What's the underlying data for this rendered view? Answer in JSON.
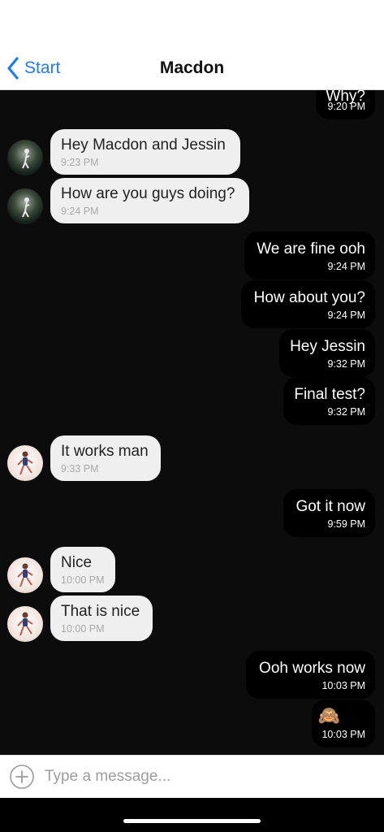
{
  "header": {
    "back_label": "Start",
    "title": "Macdon"
  },
  "messages": [
    {
      "side": "out",
      "text": "Why?",
      "time": "9:20 PM"
    },
    {
      "side": "in",
      "avatar": "dark-portrait",
      "text": "Hey Macdon and Jessin",
      "time": "9:23 PM"
    },
    {
      "side": "in",
      "avatar": "dark-portrait",
      "text": "How are you guys doing?",
      "time": "9:24 PM"
    },
    {
      "side": "out",
      "text": "We are fine ooh",
      "time": "9:24 PM"
    },
    {
      "side": "out",
      "text": "How about you?",
      "time": "9:24 PM"
    },
    {
      "side": "out",
      "text": "Hey Jessin",
      "time": "9:32 PM"
    },
    {
      "side": "out",
      "text": "Final test?",
      "time": "9:32 PM"
    },
    {
      "side": "in",
      "avatar": "light-portrait",
      "text": "It works man",
      "time": "9:33 PM"
    },
    {
      "side": "out",
      "text": "Got it now",
      "time": "9:59 PM"
    },
    {
      "side": "in",
      "avatar": "light-portrait",
      "text": "Nice",
      "time": "10:00 PM"
    },
    {
      "side": "in",
      "avatar": "light-portrait",
      "text": "That is nice",
      "time": "10:00 PM"
    },
    {
      "side": "out",
      "text": "Ooh works now",
      "time": "10:03 PM"
    },
    {
      "side": "out",
      "text": "🙈",
      "time": "10:03 PM"
    }
  ],
  "composer": {
    "placeholder": "Type a message...",
    "add_icon": "plus-circle-icon"
  },
  "colors": {
    "accent": "#1e7bf6",
    "chat_background": "#0b0c0b",
    "outgoing_bubble": "#000000",
    "incoming_bubble": "#efefef"
  }
}
